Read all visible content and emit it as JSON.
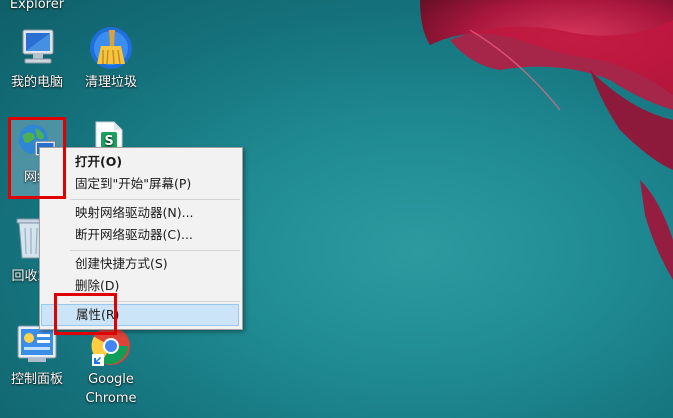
{
  "desktop": {
    "top_partial_label": "Explorer",
    "icons": [
      {
        "label": "我的电脑"
      },
      {
        "label": "清理垃圾"
      },
      {
        "label": "网络"
      },
      {
        "label": "回收站"
      },
      {
        "label": "控制面板"
      },
      {
        "label": "Google\nChrome"
      }
    ]
  },
  "context_menu": {
    "items": [
      {
        "label": "打开(O)"
      },
      {
        "label": "固定到\"开始\"屏幕(P)"
      },
      {
        "label": "映射网络驱动器(N)..."
      },
      {
        "label": "断开网络驱动器(C)..."
      },
      {
        "label": "创建快捷方式(S)"
      },
      {
        "label": "删除(D)"
      },
      {
        "label": "属性(R)"
      }
    ]
  },
  "colors": {
    "highlight_box": "#e00000",
    "wallpaper_teal": "#1f8a92",
    "flower_red": "#b0123a"
  }
}
